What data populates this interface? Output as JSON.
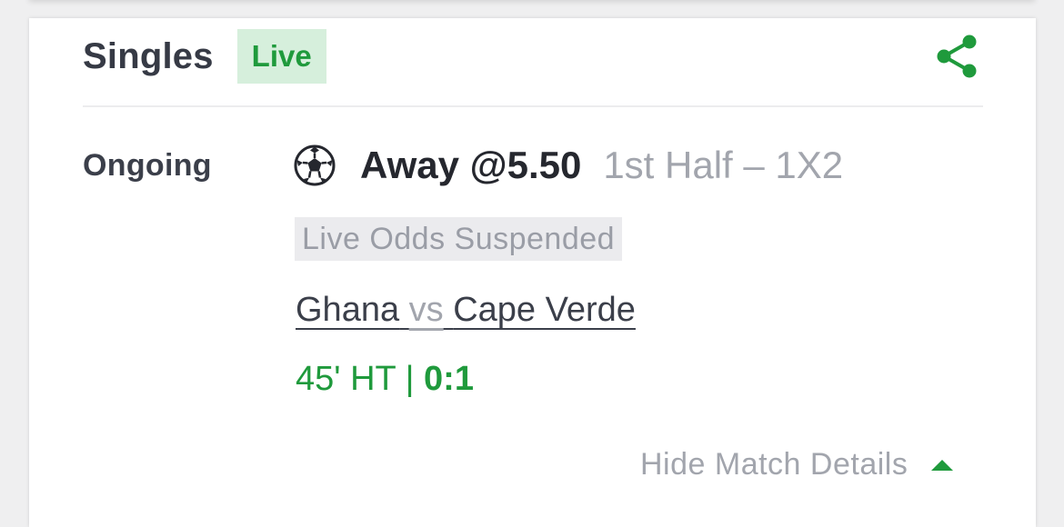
{
  "bet": {
    "type_label": "Singles",
    "live_badge": "Live",
    "status": "Ongoing",
    "pick": "Away @5.50",
    "market": "1st Half  –  1X2",
    "odds_status": "Live Odds Suspended"
  },
  "match": {
    "home": "Ghana",
    "vs": "vs",
    "away": "Cape Verde",
    "clock": "45' HT | ",
    "score": "0:1"
  },
  "actions": {
    "toggle_details": "Hide Match Details"
  },
  "icons": {
    "share": "share-icon",
    "sport": "soccer-ball-icon",
    "toggle": "caret-up-icon"
  },
  "colors": {
    "accent_green": "#1f9a3c",
    "live_badge_bg": "#d6efdc",
    "text_dark": "#363a45",
    "text_muted": "#a2a5ad"
  }
}
